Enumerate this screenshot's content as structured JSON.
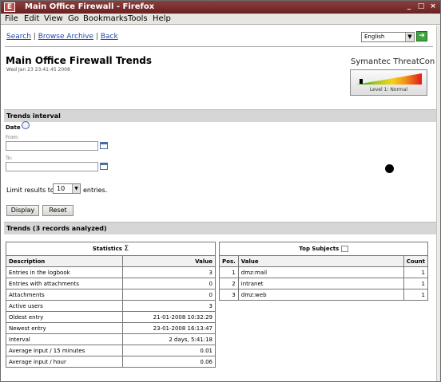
{
  "window": {
    "app_icon": "E",
    "title": "Main Office Firewall - Firefox",
    "controls": [
      "_",
      "□",
      "×"
    ]
  },
  "menu": [
    "File",
    "Edit",
    "View",
    "Go",
    "Bookmarks",
    "Tools",
    "Help"
  ],
  "nav": {
    "search": "Search",
    "browse_archive": "Browse Archive",
    "back": "Back",
    "separator": "|"
  },
  "language": {
    "selected": "English"
  },
  "page": {
    "title": "Main Office Firewall Trends",
    "timestamp": "Wed Jan 23 23:41:45 2008"
  },
  "threatcon": {
    "label": "Symantec ThreatCon",
    "level": "Level 1: Normal",
    "level_fraction": 0.05
  },
  "trends_interval": {
    "heading": "Trends interval",
    "date_label": "Date",
    "from_label": "From:",
    "to_label": "To:",
    "from_value": "",
    "to_value": "",
    "limit_prefix": "Limit results to",
    "limit_value": "10",
    "limit_suffix": "entries.",
    "display_button": "Display",
    "reset_button": "Reset"
  },
  "trends": {
    "heading": "Trends (3 records analyzed)"
  },
  "statistics": {
    "caption": "Statistics",
    "col_description": "Description",
    "col_value": "Value",
    "rows": [
      {
        "desc": "Entries in the logbook",
        "value": "3"
      },
      {
        "desc": "Entries with attachments",
        "value": "0"
      },
      {
        "desc": "Attachments",
        "value": "0"
      },
      {
        "desc": "Active users",
        "value": "3"
      },
      {
        "desc": "Oldest entry",
        "value": "21-01-2008 10:32:29"
      },
      {
        "desc": "Newest entry",
        "value": "23-01-2008 16:13:47"
      },
      {
        "desc": "Interval",
        "value": "2 days, 5:41:18"
      },
      {
        "desc": "Average input / 15 minutes",
        "value": "0.01"
      },
      {
        "desc": "Average input / hour",
        "value": "0.06"
      }
    ]
  },
  "top_subjects": {
    "caption": "Top Subjects",
    "col_pos": "Pos.",
    "col_value": "Value",
    "col_count": "Count",
    "rows": [
      {
        "pos": "1",
        "value": "dmz:mail",
        "count": "1"
      },
      {
        "pos": "2",
        "value": "intranet",
        "count": "1"
      },
      {
        "pos": "3",
        "value": "dmz:web",
        "count": "1"
      }
    ]
  }
}
